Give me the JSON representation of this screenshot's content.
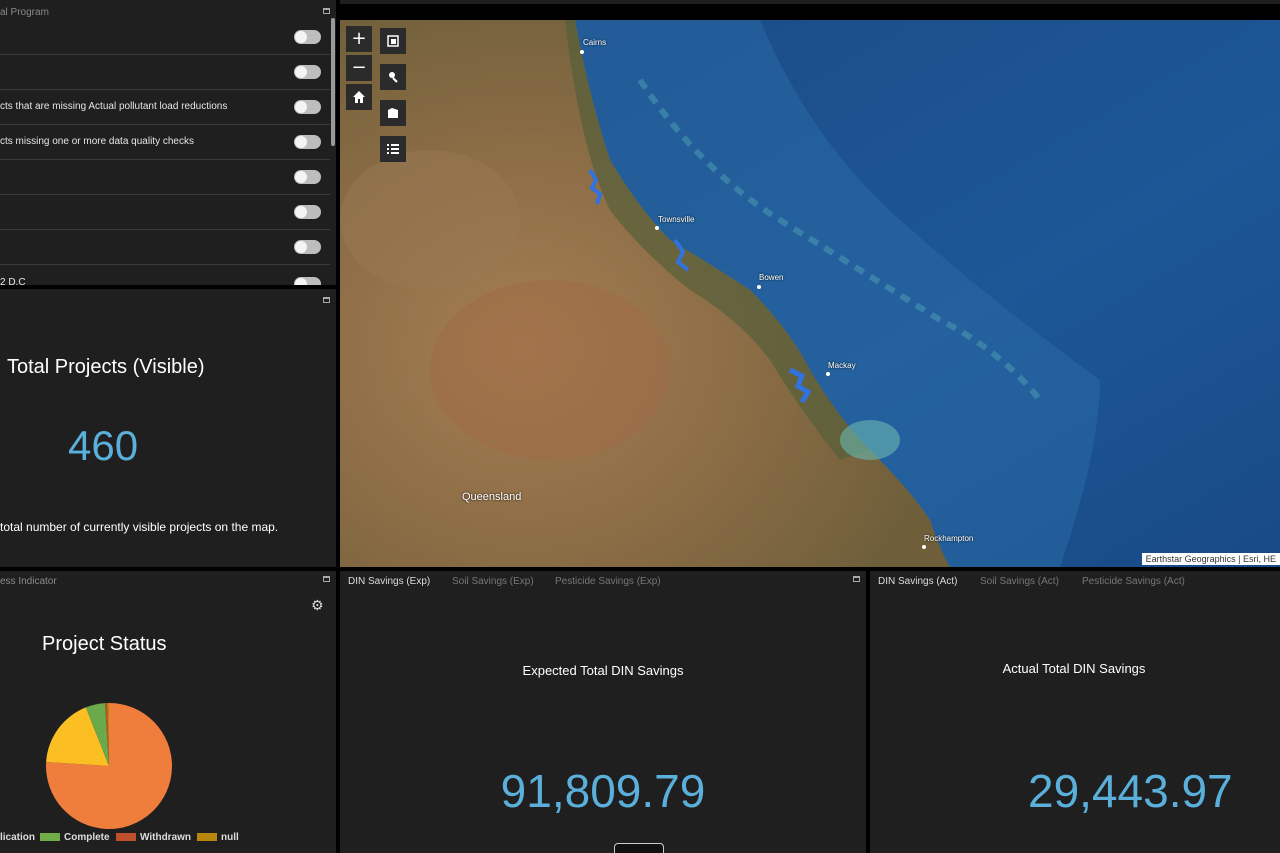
{
  "filters_panel": {
    "title": "al Program",
    "items": [
      {
        "label": ""
      },
      {
        "label": ""
      },
      {
        "label": "cts that are missing Actual pollutant load reductions"
      },
      {
        "label": "cts missing one or more data quality checks"
      },
      {
        "label": ""
      },
      {
        "label": ""
      },
      {
        "label": ""
      },
      {
        "label": "2 D.C"
      }
    ]
  },
  "total_projects": {
    "title": "Total Projects (Visible)",
    "value": "460",
    "description": "total number of currently visible projects on the map."
  },
  "map": {
    "cities": [
      {
        "name": "Cairns"
      },
      {
        "name": "Townsville"
      },
      {
        "name": "Bowen"
      },
      {
        "name": "Mackay"
      },
      {
        "name": "Rockhampton"
      }
    ],
    "region_label": "Queensland",
    "attribution": "Earthstar Geographics | Esri, HE",
    "buttons": {
      "zoom_in": "+",
      "zoom_out": "−"
    }
  },
  "status_panel": {
    "title": "ess Indicator",
    "chart_title": "Project Status",
    "legend": [
      {
        "label": "lication",
        "color": "#f28a3c"
      },
      {
        "label": "Complete",
        "color": "#70ad47"
      },
      {
        "label": "Withdrawn",
        "color": "#c0502b"
      },
      {
        "label": "null",
        "color": "#b8860b"
      }
    ]
  },
  "chart_data": {
    "type": "pie",
    "title": "Project Status",
    "categories": [
      "lication",
      "Complete",
      "Withdrawn",
      "null"
    ],
    "values": [
      76,
      5,
      0.5,
      0.5
    ],
    "extra_slices": [
      {
        "value": 18,
        "color": "#fbbf24"
      }
    ],
    "colors": [
      "#ef7d3c",
      "#6aaa4a",
      "#c0502b",
      "#b8860b"
    ]
  },
  "expected_panel": {
    "tabs": [
      "DIN Savings (Exp)",
      "Soil Savings (Exp)",
      "Pesticide Savings (Exp)"
    ],
    "title": "Expected Total DIN Savings",
    "value": "91,809.79"
  },
  "actual_panel": {
    "tabs": [
      "DIN Savings (Act)",
      "Soil Savings (Act)",
      "Pesticide Savings (Act)"
    ],
    "title": "Actual Total DIN Savings",
    "value": "29,443.97"
  }
}
